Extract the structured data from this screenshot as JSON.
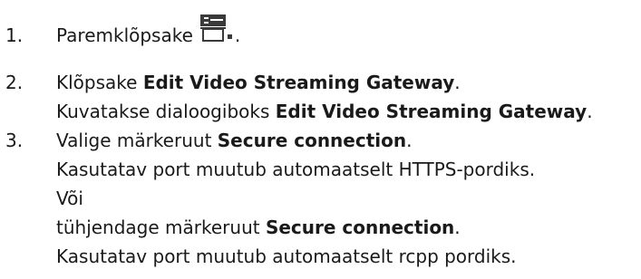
{
  "steps": [
    {
      "number": "1.",
      "lines": [
        {
          "text": "Paremklõpsake",
          "suffix": "."
        }
      ],
      "icon": "vsg-device-icon"
    },
    {
      "number": "2.",
      "lines": [
        {
          "pre": "Klõpsake ",
          "bold": "Edit Video Streaming Gateway",
          "post": "."
        },
        {
          "pre": "Kuvatakse dialoogiboks ",
          "bold": "Edit Video Streaming Gateway",
          "post": "."
        }
      ]
    },
    {
      "number": "3.",
      "lines": [
        {
          "pre": "Valige märkeruut ",
          "bold": "Secure connection",
          "post": "."
        },
        {
          "pre": "Kasutatav port muutub automaatselt HTTPS-pordiks."
        },
        {
          "pre": "Või"
        },
        {
          "pre": "tühjendage märkeruut ",
          "bold": "Secure connection",
          "post": "."
        },
        {
          "pre": "Kasutatav port muutub automaatselt rcpp pordiks."
        }
      ]
    }
  ],
  "colors": {
    "text": "#1a1a1a",
    "icon_dark": "#3a3a3a",
    "icon_light": "#ffffff"
  }
}
